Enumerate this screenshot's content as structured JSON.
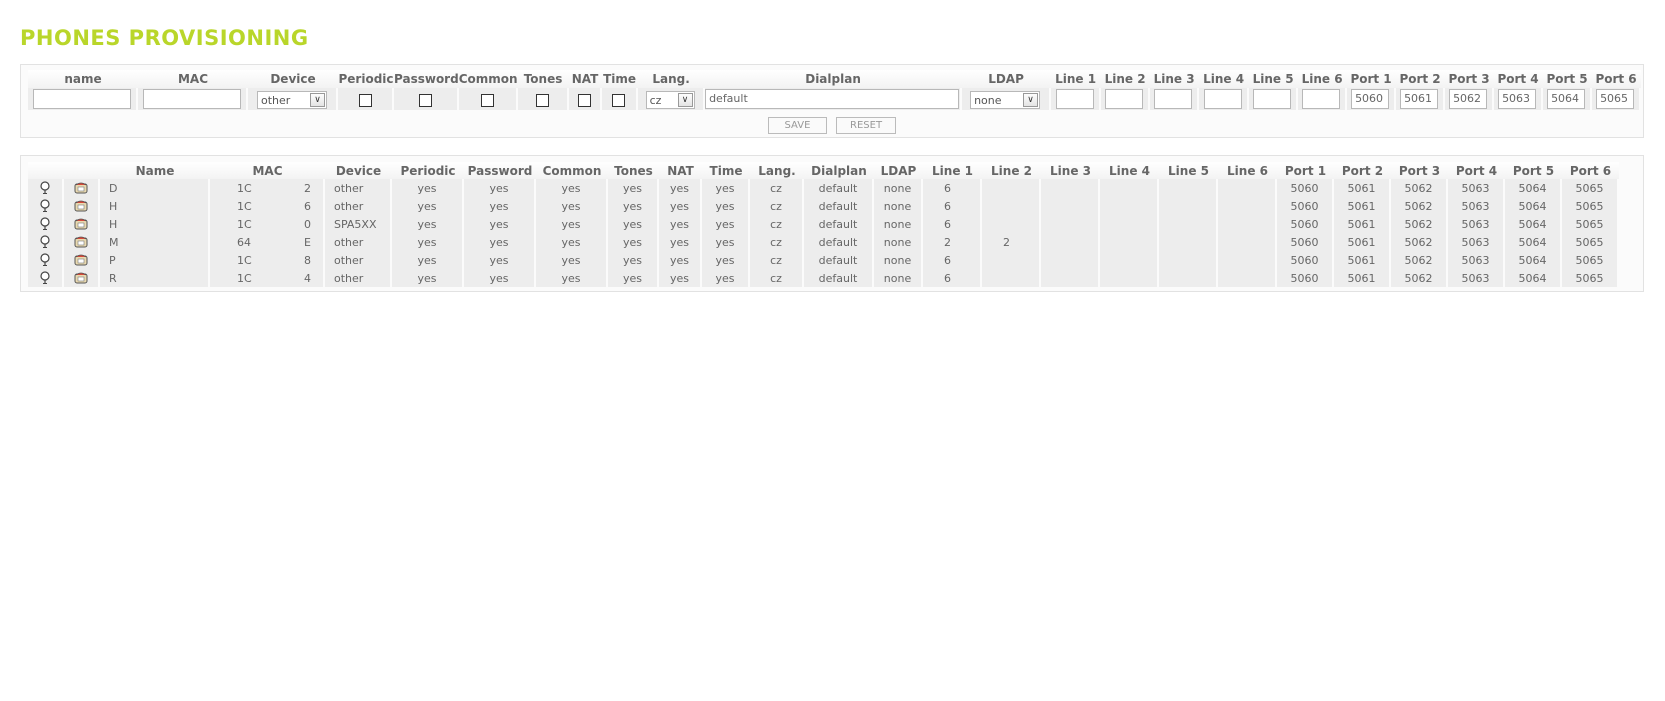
{
  "page_title": "PHONES PROVISIONING",
  "form": {
    "headers": [
      "name",
      "MAC",
      "Device",
      "Periodic",
      "Password",
      "Common",
      "Tones",
      "NAT",
      "Time",
      "Lang.",
      "Dialplan",
      "LDAP",
      "Line 1",
      "Line 2",
      "Line 3",
      "Line 4",
      "Line 5",
      "Line 6",
      "Port 1",
      "Port 2",
      "Port 3",
      "Port 4",
      "Port 5",
      "Port 6"
    ],
    "name_value": "",
    "mac_value": "",
    "device_selected": "other",
    "lang_selected": "cz",
    "dialplan_value": "default",
    "ldap_selected": "none",
    "lines": [
      "",
      "",
      "",
      "",
      "",
      ""
    ],
    "ports": [
      "5060",
      "5061",
      "5062",
      "5063",
      "5064",
      "5065"
    ],
    "save_label": "SAVE",
    "reset_label": "RESET"
  },
  "list": {
    "headers": [
      "",
      "",
      "Name",
      "MAC",
      "Device",
      "Periodic",
      "Password",
      "Common",
      "Tones",
      "NAT",
      "Time",
      "Lang.",
      "Dialplan",
      "LDAP",
      "Line 1",
      "Line 2",
      "Line 3",
      "Line 4",
      "Line 5",
      "Line 6",
      "Port 1",
      "Port 2",
      "Port 3",
      "Port 4",
      "Port 5",
      "Port 6"
    ],
    "row_icons": [
      "bulb-icon",
      "phone-icon"
    ],
    "rows": [
      {
        "name": "D",
        "mac_prefix": "1C",
        "mac_suffix": "2",
        "device": "other",
        "periodic": "yes",
        "password": "yes",
        "common": "yes",
        "tones": "yes",
        "nat": "yes",
        "time": "yes",
        "lang": "cz",
        "dialplan": "default",
        "ldap": "none",
        "line1": "6",
        "line2": "",
        "line3": "",
        "line4": "",
        "line5": "",
        "line6": "",
        "port1": "5060",
        "port2": "5061",
        "port3": "5062",
        "port4": "5063",
        "port5": "5064",
        "port6": "5065"
      },
      {
        "name": "H",
        "mac_prefix": "1C",
        "mac_suffix": "6",
        "device": "other",
        "periodic": "yes",
        "password": "yes",
        "common": "yes",
        "tones": "yes",
        "nat": "yes",
        "time": "yes",
        "lang": "cz",
        "dialplan": "default",
        "ldap": "none",
        "line1": "6",
        "line2": "",
        "line3": "",
        "line4": "",
        "line5": "",
        "line6": "",
        "port1": "5060",
        "port2": "5061",
        "port3": "5062",
        "port4": "5063",
        "port5": "5064",
        "port6": "5065"
      },
      {
        "name": "H",
        "mac_prefix": "1C",
        "mac_suffix": "0",
        "device": "SPA5XX",
        "periodic": "yes",
        "password": "yes",
        "common": "yes",
        "tones": "yes",
        "nat": "yes",
        "time": "yes",
        "lang": "cz",
        "dialplan": "default",
        "ldap": "none",
        "line1": "6",
        "line2": "",
        "line3": "",
        "line4": "",
        "line5": "",
        "line6": "",
        "port1": "5060",
        "port2": "5061",
        "port3": "5062",
        "port4": "5063",
        "port5": "5064",
        "port6": "5065"
      },
      {
        "name": "M",
        "mac_prefix": "64",
        "mac_suffix": "E",
        "device": "other",
        "periodic": "yes",
        "password": "yes",
        "common": "yes",
        "tones": "yes",
        "nat": "yes",
        "time": "yes",
        "lang": "cz",
        "dialplan": "default",
        "ldap": "none",
        "line1": "2",
        "line2": "2",
        "line3": "",
        "line4": "",
        "line5": "",
        "line6": "",
        "port1": "5060",
        "port2": "5061",
        "port3": "5062",
        "port4": "5063",
        "port5": "5064",
        "port6": "5065"
      },
      {
        "name": "P",
        "mac_prefix": "1C",
        "mac_suffix": "8",
        "device": "other",
        "periodic": "yes",
        "password": "yes",
        "common": "yes",
        "tones": "yes",
        "nat": "yes",
        "time": "yes",
        "lang": "cz",
        "dialplan": "default",
        "ldap": "none",
        "line1": "6",
        "line2": "",
        "line3": "",
        "line4": "",
        "line5": "",
        "line6": "",
        "port1": "5060",
        "port2": "5061",
        "port3": "5062",
        "port4": "5063",
        "port5": "5064",
        "port6": "5065"
      },
      {
        "name": "R",
        "mac_prefix": "1C",
        "mac_suffix": "4",
        "device": "other",
        "periodic": "yes",
        "password": "yes",
        "common": "yes",
        "tones": "yes",
        "nat": "yes",
        "time": "yes",
        "lang": "cz",
        "dialplan": "default",
        "ldap": "none",
        "line1": "6",
        "line2": "",
        "line3": "",
        "line4": "",
        "line5": "",
        "line6": "",
        "port1": "5060",
        "port2": "5061",
        "port3": "5062",
        "port4": "5063",
        "port5": "5064",
        "port6": "5065"
      }
    ]
  },
  "colors": {
    "title_green": "#b9d62a",
    "cell_bg": "#ededed",
    "text": "#666666"
  }
}
